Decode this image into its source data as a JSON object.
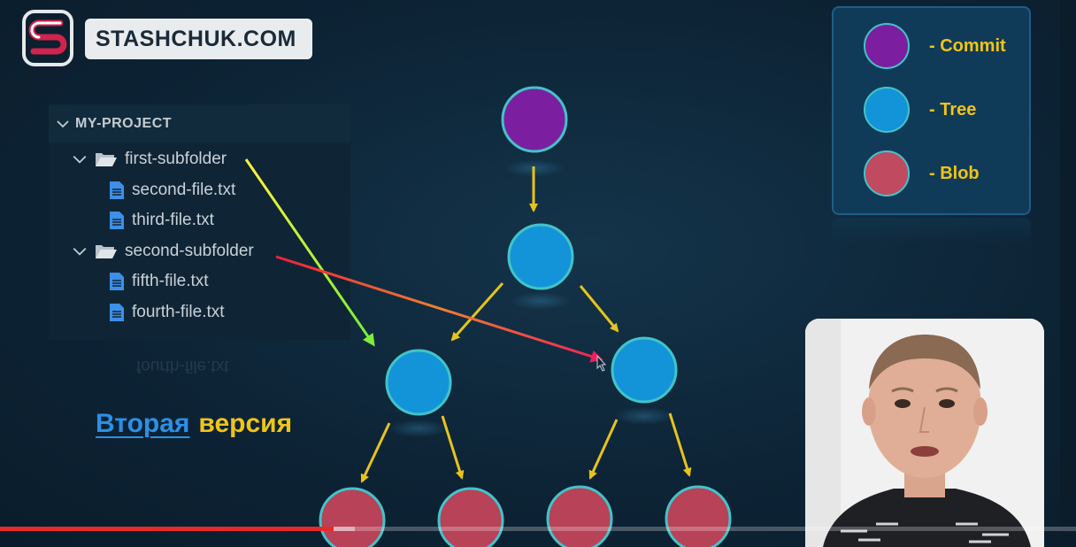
{
  "brand": {
    "site": "STASHCHUK.COM"
  },
  "explorer": {
    "project": "MY-PROJECT",
    "items": [
      {
        "label": "first-subfolder",
        "kind": "folder"
      },
      {
        "label": "second-file.txt",
        "kind": "file"
      },
      {
        "label": "third-file.txt",
        "kind": "file"
      },
      {
        "label": "second-subfolder",
        "kind": "folder"
      },
      {
        "label": "fifth-file.txt",
        "kind": "file"
      },
      {
        "label": "fourth-file.txt",
        "kind": "file"
      }
    ],
    "reflection": "fourth-file.txt"
  },
  "legend": {
    "items": [
      {
        "label": "- Commit",
        "color": "#7b1fa0"
      },
      {
        "label": "- Tree",
        "color": "#1394d9"
      },
      {
        "label": "- Blob",
        "color": "#c04a60"
      }
    ]
  },
  "caption": {
    "word1": "Вторая",
    "word2": "версия"
  },
  "colors": {
    "commit": "#7b1fa0",
    "tree": "#1394d9",
    "blob": "#b84257",
    "node_stroke": "#43c3c9",
    "arrow_yellow": "#e7c31b",
    "accent_red": "#e52a2a"
  },
  "video": {
    "progress": 0.31,
    "buffered": 0.02
  }
}
